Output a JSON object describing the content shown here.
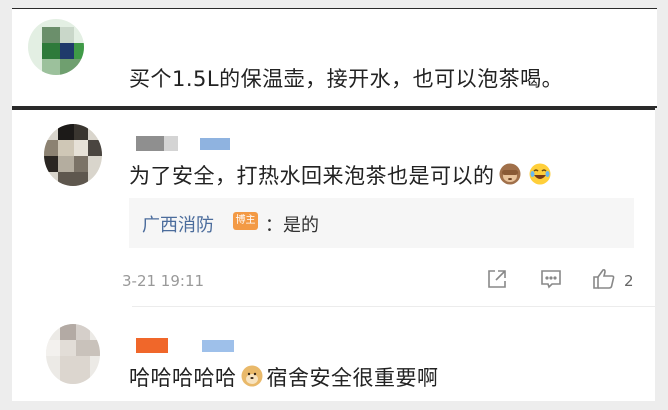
{
  "comment_top": {
    "text": "买个1.5L的保温壶，接开水，也可以泡茶喝。"
  },
  "comment_main": {
    "text": "为了安全，打热水回来泡茶也是可以的",
    "emojis": [
      "see-no-evil-monkey-icon",
      "laughing-tears-icon"
    ],
    "reply": {
      "user": "广西消防",
      "badge": "博主",
      "text": "：是的"
    },
    "time": "3-21 19:11",
    "like_count": "2"
  },
  "comment_bottom": {
    "text_before": "哈哈哈哈哈",
    "text_after": "宿舍安全很重要啊",
    "emoji": "doge-icon"
  },
  "colors": {
    "link": "#4b6c9c",
    "badge": "#f39a45",
    "muted": "#999999"
  }
}
